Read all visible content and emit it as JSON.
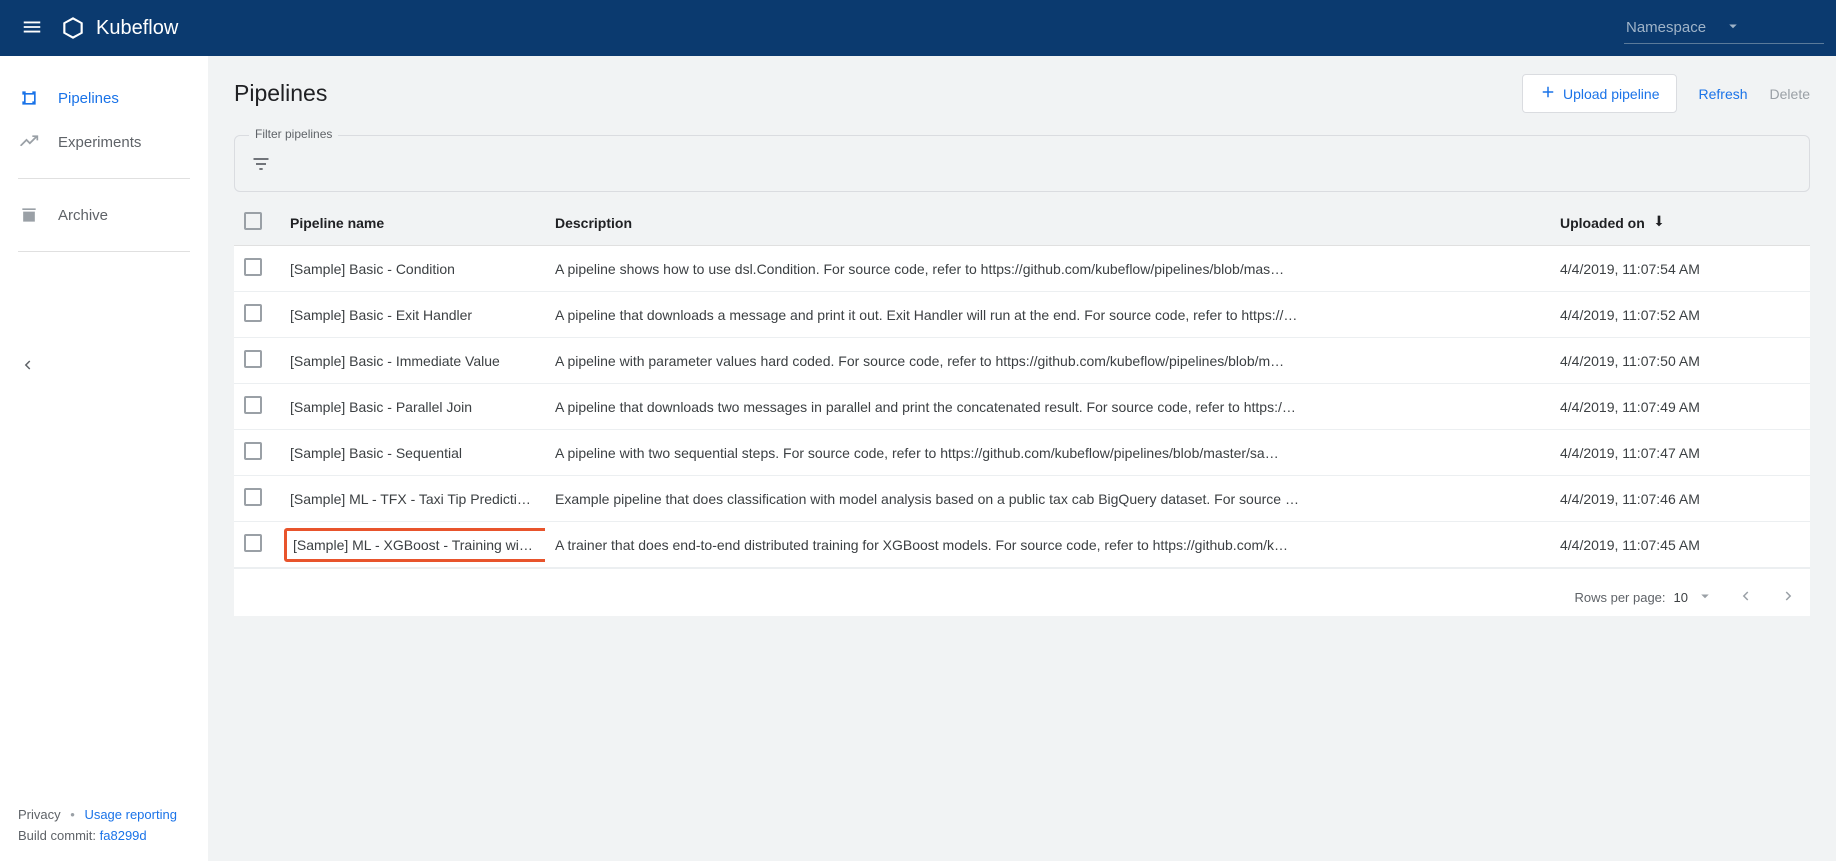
{
  "header": {
    "brand": "Kubeflow",
    "namespace_label": "Namespace"
  },
  "sidebar": {
    "items": [
      {
        "label": "Pipelines",
        "active": true
      },
      {
        "label": "Experiments",
        "active": false
      },
      {
        "label": "Archive",
        "active": false
      }
    ],
    "privacy": "Privacy",
    "usage": "Usage reporting",
    "build_prefix": "Build commit: ",
    "build_hash": "fa8299d"
  },
  "page": {
    "title": "Pipelines",
    "upload_label": "Upload pipeline",
    "refresh_label": "Refresh",
    "delete_label": "Delete",
    "filter_legend": "Filter pipelines"
  },
  "table": {
    "columns": {
      "name": "Pipeline name",
      "description": "Description",
      "uploaded": "Uploaded on"
    },
    "rows": [
      {
        "name": "[Sample] Basic - Condition",
        "description": "A pipeline shows how to use dsl.Condition. For source code, refer to https://github.com/kubeflow/pipelines/blob/mas…",
        "uploaded": "4/4/2019, 11:07:54 AM",
        "highlight": false
      },
      {
        "name": "[Sample] Basic - Exit Handler",
        "description": "A pipeline that downloads a message and print it out. Exit Handler will run at the end. For source code, refer to https://…",
        "uploaded": "4/4/2019, 11:07:52 AM",
        "highlight": false
      },
      {
        "name": "[Sample] Basic - Immediate Value",
        "description": "A pipeline with parameter values hard coded. For source code, refer to https://github.com/kubeflow/pipelines/blob/m…",
        "uploaded": "4/4/2019, 11:07:50 AM",
        "highlight": false
      },
      {
        "name": "[Sample] Basic - Parallel Join",
        "description": "A pipeline that downloads two messages in parallel and print the concatenated result. For source code, refer to https:/…",
        "uploaded": "4/4/2019, 11:07:49 AM",
        "highlight": false
      },
      {
        "name": "[Sample] Basic - Sequential",
        "description": "A pipeline with two sequential steps. For source code, refer to https://github.com/kubeflow/pipelines/blob/master/sa…",
        "uploaded": "4/4/2019, 11:07:47 AM",
        "highlight": false
      },
      {
        "name": "[Sample] ML - TFX - Taxi Tip Predictio…",
        "description": "Example pipeline that does classification with model analysis based on a public tax cab BigQuery dataset. For source …",
        "uploaded": "4/4/2019, 11:07:46 AM",
        "highlight": false
      },
      {
        "name": "[Sample] ML - XGBoost - Training with …",
        "description": "A trainer that does end-to-end distributed training for XGBoost models. For source code, refer to https://github.com/k…",
        "uploaded": "4/4/2019, 11:07:45 AM",
        "highlight": true
      }
    ],
    "pager": {
      "rows_per_page_label": "Rows per page:",
      "rows_per_page_value": "10"
    }
  }
}
